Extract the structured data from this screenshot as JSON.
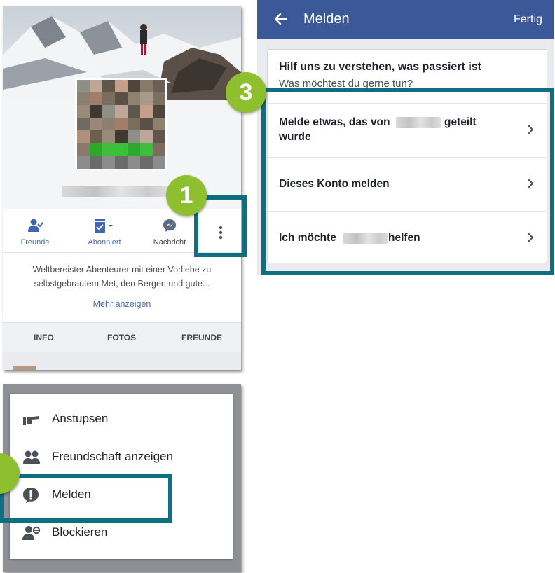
{
  "profile": {
    "actions": {
      "friends": "Freunde",
      "subscribed": "Abonniert",
      "message": "Nachricht"
    },
    "bio": "Weltbereister Abenteurer mit einer Vorliebe zu selbstgebrautem Met, den Bergen und gute...",
    "show_more": "Mehr anzeigen",
    "tabs": [
      "INFO",
      "FOTOS",
      "FREUNDE"
    ]
  },
  "menu": {
    "items": [
      "Anstupsen",
      "Freundschaft anzeigen",
      "Melden",
      "Blockieren"
    ]
  },
  "report": {
    "title": "Melden",
    "done": "Fertig",
    "heading": "Hilf uns zu verstehen, was passiert ist",
    "subheading": "Was möchtest du gerne tun?",
    "options": [
      {
        "before": "Melde etwas, das von",
        "after": "geteilt",
        "line2": "wurde"
      },
      {
        "text": "Dieses Konto melden"
      },
      {
        "before": "Ich möchte",
        "after": "helfen"
      }
    ]
  },
  "callouts": [
    "1",
    "3"
  ],
  "colors": {
    "facebook_blue": "#3b5998",
    "highlight": "#0d6f80",
    "badge": "#8dbf2e"
  },
  "icons": {
    "back": "arrow-left-icon",
    "chevron": "chevron-right-icon",
    "friends": "friend-check-icon",
    "subscribed": "subscribe-icon",
    "message": "messenger-icon",
    "more": "more-vertical-icon",
    "poke": "poke-hand-icon",
    "friendship": "two-people-icon",
    "report": "alert-icon",
    "block": "block-user-icon"
  }
}
